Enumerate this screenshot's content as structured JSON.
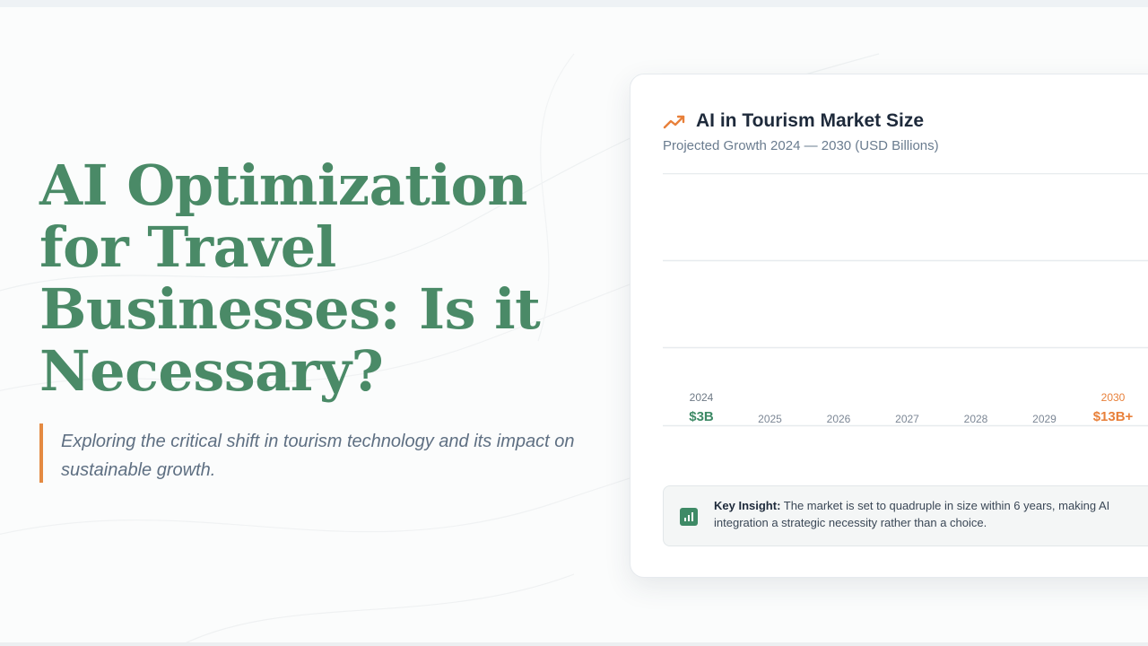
{
  "hero": {
    "title": "AI Optimization for Travel Businesses: Is it Necessary?",
    "subtitle": "Exploring the critical shift in tourism technology and its impact on sustainable growth."
  },
  "card": {
    "icon": "trending-up-icon",
    "title": "AI in Tourism Market Size",
    "subtitle": "Projected Growth 2024 — 2030 (USD Billions)",
    "insight": {
      "icon": "bar-chart-icon",
      "label": "Key Insight:",
      "text": " The market is set to quadruple in size within 6 years, making AI integration a strategic necessity rather than a choice."
    }
  },
  "colors": {
    "title_green": "#4a8a67",
    "accent_orange": "#e48a42",
    "gridline": "#e7ebee"
  },
  "chart_data": {
    "type": "bar",
    "title": "AI in Tourism Market Size",
    "subtitle": "Projected Growth 2024 — 2030 (USD Billions)",
    "categories": [
      "2024",
      "2025",
      "2026",
      "2027",
      "2028",
      "2029",
      "2030"
    ],
    "value_labels": [
      "$3B",
      "",
      "",
      "",
      "",
      "",
      "$13B+"
    ],
    "highlight_categories": [
      "2024",
      "2030"
    ],
    "values": [
      3,
      null,
      null,
      null,
      null,
      null,
      13
    ],
    "ylabel": "",
    "xlabel": "",
    "grid": true,
    "colors": {
      "2024": "#3e8a66",
      "2030": "#e8803a",
      "default": "#7c8795"
    }
  }
}
